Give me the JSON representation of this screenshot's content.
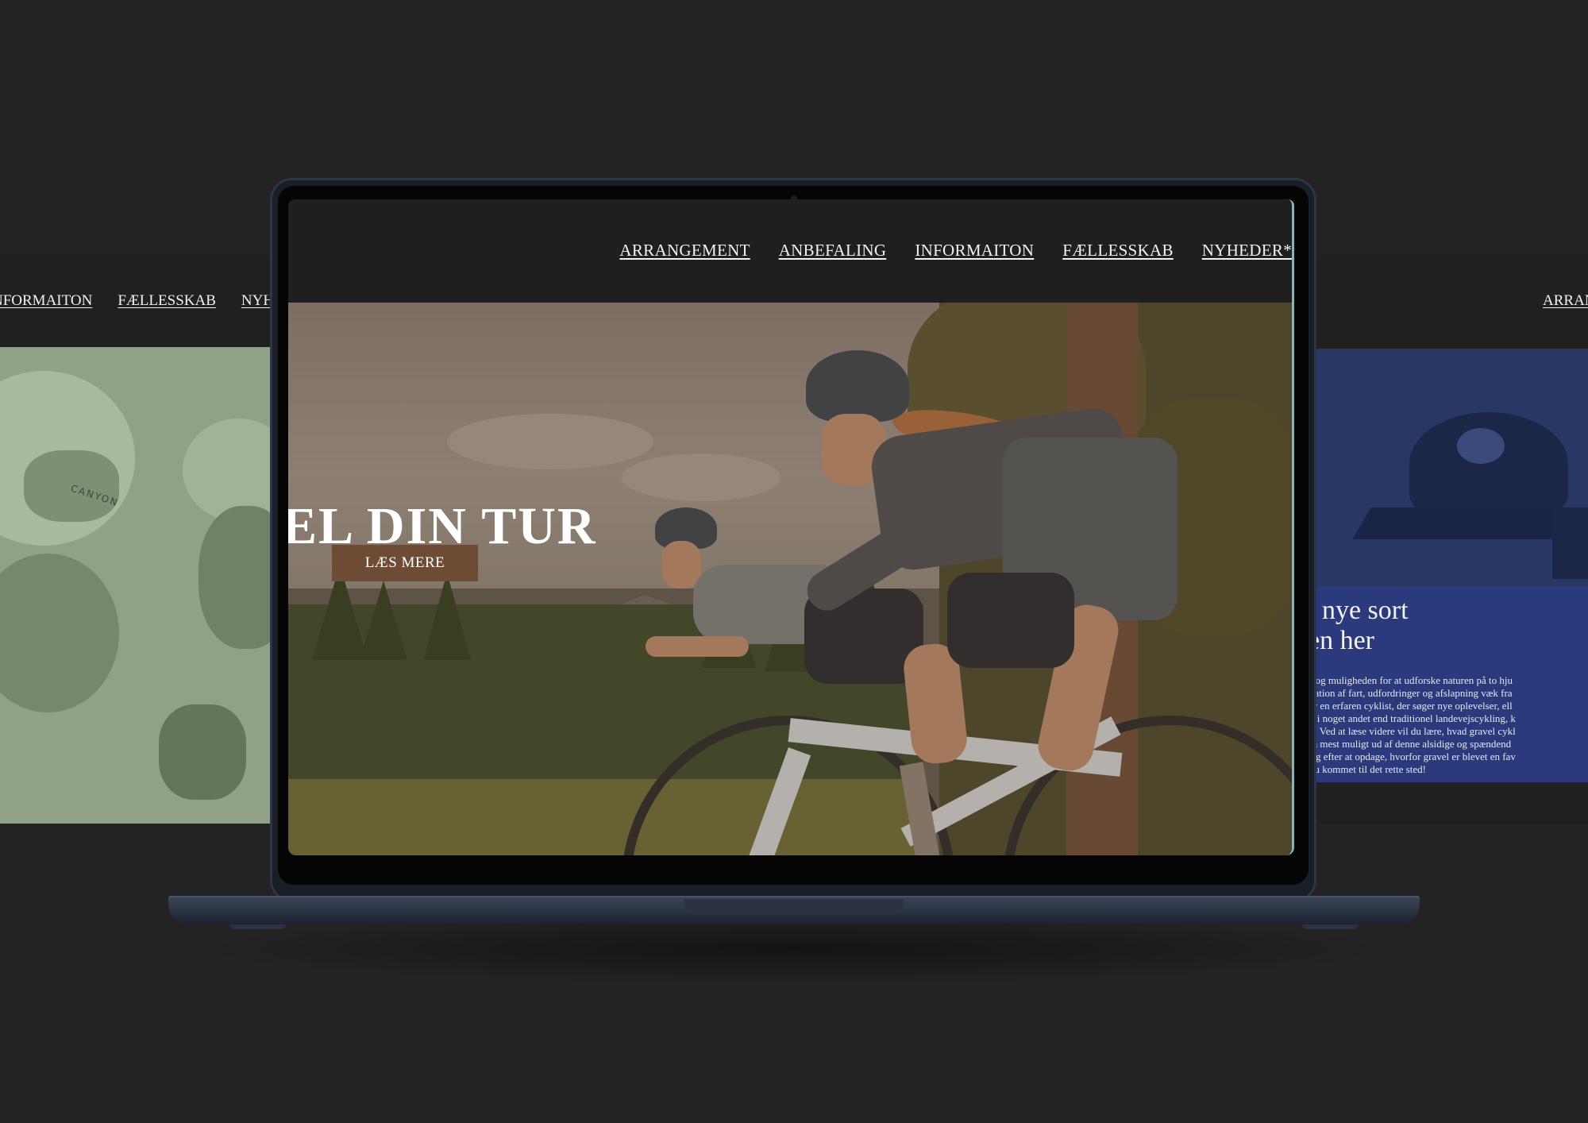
{
  "left_page": {
    "nav": [
      "NFORMAITON",
      "FÆLLESSKAB",
      "NYH"
    ],
    "image_text": "CANYON",
    "image_tint": "#8fa285"
  },
  "right_page": {
    "nav": [
      "ARRAN"
    ],
    "image_tint": "#283764",
    "card_color": "#2a3a7d",
    "title_lines": [
      "t nye sort",
      "en her"
    ],
    "body_lines": [
      "r og muligheden for at udforske naturen på to hju",
      "nation af fart, udfordringer og afslapning væk fra",
      " er en erfaren cyklist, der søger nye oplevelser, ell",
      "d i noget andet end traditionel landevejscykling, k",
      "n. Ved at læse videre vil du lære, hvad gravel cykl",
      " få mest muligt ud af denne alsidige og spændend",
      "rig efter at opdage, hvorfor gravel er blevet en fav",
      " du kommet til det rette sted!"
    ]
  },
  "main_site": {
    "nav": [
      "ARRANGEMENT",
      "ANBEFALING",
      "INFORMAITON",
      "FÆLLESSKAB",
      "NYHEDER*"
    ],
    "hero_title": "EL DIN TUR",
    "hero_button": "LÆS MERE",
    "button_color": "#6e4b34"
  }
}
